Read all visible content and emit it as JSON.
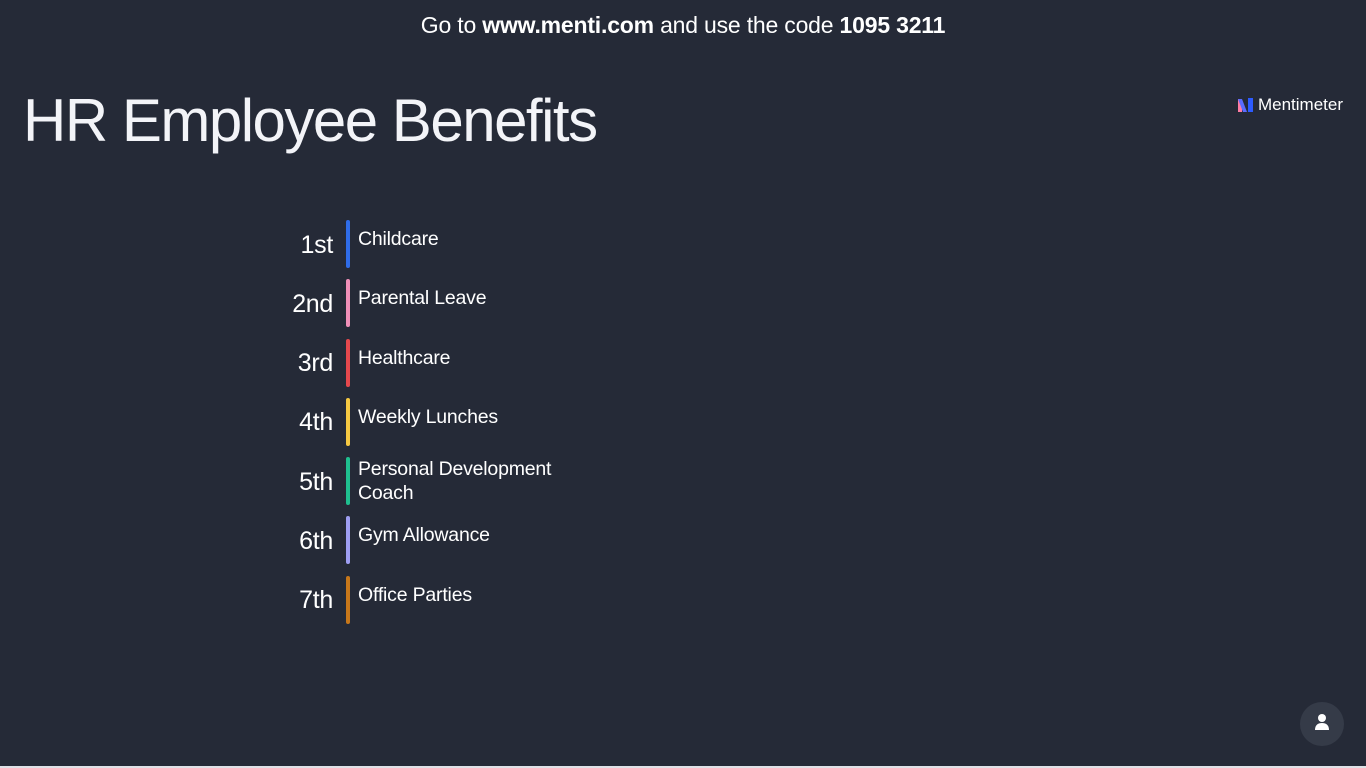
{
  "header": {
    "prefix": "Go to ",
    "url": "www.menti.com",
    "middle": " and use the code ",
    "code": "1095 3211"
  },
  "title": "HR Employee Benefits",
  "brand": {
    "name": "Mentimeter",
    "icon": "mentimeter-logo"
  },
  "ranking": [
    {
      "rank": "1st",
      "label": "Childcare",
      "color": "#2f6ce8"
    },
    {
      "rank": "2nd",
      "label": "Parental Leave",
      "color": "#f08fb8"
    },
    {
      "rank": "3rd",
      "label": "Healthcare",
      "color": "#e5484d"
    },
    {
      "rank": "4th",
      "label": "Weekly Lunches",
      "color": "#f5c842"
    },
    {
      "rank": "5th",
      "label": "Personal Development Coach",
      "color": "#1fbf8f"
    },
    {
      "rank": "6th",
      "label": "Gym Allowance",
      "color": "#9e9ef2"
    },
    {
      "rank": "7th",
      "label": "Office Parties",
      "color": "#c7771a"
    }
  ],
  "footer": {
    "avatar_icon": "user-icon"
  }
}
